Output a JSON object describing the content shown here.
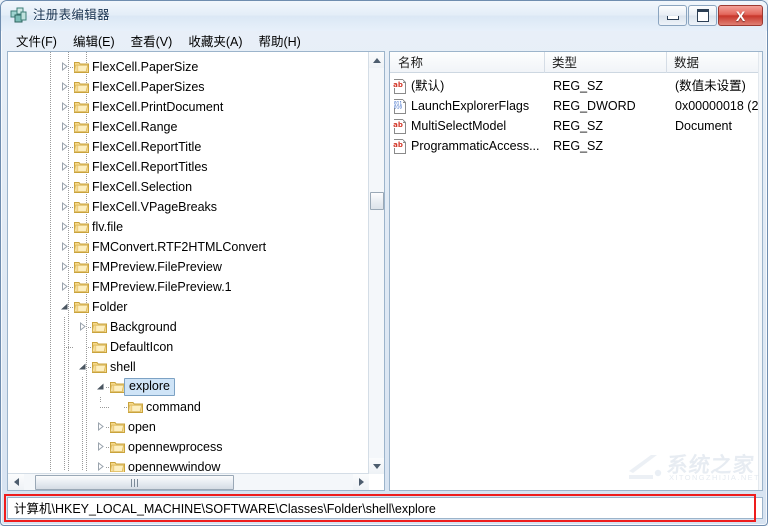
{
  "window": {
    "title": "注册表编辑器",
    "icon": "registry-editor-icon",
    "controls": {
      "minimize": "—",
      "maximize": "□",
      "close": "X"
    }
  },
  "menubar": {
    "items": [
      {
        "label": "文件(F)"
      },
      {
        "label": "编辑(E)"
      },
      {
        "label": "查看(V)"
      },
      {
        "label": "收藏夹(A)"
      },
      {
        "label": "帮助(H)"
      }
    ]
  },
  "tree": {
    "nodes": [
      {
        "label": "FlexCell.PaperSize",
        "depth": 3,
        "state": "collapsed",
        "selected": false
      },
      {
        "label": "FlexCell.PaperSizes",
        "depth": 3,
        "state": "collapsed",
        "selected": false
      },
      {
        "label": "FlexCell.PrintDocument",
        "depth": 3,
        "state": "collapsed",
        "selected": false
      },
      {
        "label": "FlexCell.Range",
        "depth": 3,
        "state": "collapsed",
        "selected": false
      },
      {
        "label": "FlexCell.ReportTitle",
        "depth": 3,
        "state": "collapsed",
        "selected": false
      },
      {
        "label": "FlexCell.ReportTitles",
        "depth": 3,
        "state": "collapsed",
        "selected": false
      },
      {
        "label": "FlexCell.Selection",
        "depth": 3,
        "state": "collapsed",
        "selected": false
      },
      {
        "label": "FlexCell.VPageBreaks",
        "depth": 3,
        "state": "collapsed",
        "selected": false
      },
      {
        "label": "flv.file",
        "depth": 3,
        "state": "collapsed",
        "selected": false
      },
      {
        "label": "FMConvert.RTF2HTMLConvert",
        "depth": 3,
        "state": "collapsed",
        "selected": false
      },
      {
        "label": "FMPreview.FilePreview",
        "depth": 3,
        "state": "collapsed",
        "selected": false
      },
      {
        "label": "FMPreview.FilePreview.1",
        "depth": 3,
        "state": "collapsed",
        "selected": false
      },
      {
        "label": "Folder",
        "depth": 3,
        "state": "expanded",
        "selected": false
      },
      {
        "label": "Background",
        "depth": 4,
        "state": "collapsed",
        "selected": false
      },
      {
        "label": "DefaultIcon",
        "depth": 4,
        "state": "leaf",
        "selected": false
      },
      {
        "label": "shell",
        "depth": 4,
        "state": "expanded",
        "selected": false
      },
      {
        "label": "explore",
        "depth": 5,
        "state": "expanded",
        "selected": true
      },
      {
        "label": "command",
        "depth": 6,
        "state": "leaf",
        "selected": false
      },
      {
        "label": "open",
        "depth": 5,
        "state": "collapsed",
        "selected": false
      },
      {
        "label": "opennewprocess",
        "depth": 5,
        "state": "collapsed",
        "selected": false
      },
      {
        "label": "opennewwindow",
        "depth": 5,
        "state": "collapsed",
        "selected": false
      }
    ],
    "scrollbar": {
      "up_arrow_icon": "triangle-up-icon",
      "down_arrow_icon": "triangle-down-icon",
      "left_arrow_icon": "triangle-left-icon",
      "right_arrow_icon": "triangle-right-icon"
    }
  },
  "list": {
    "columns": [
      {
        "label": "名称"
      },
      {
        "label": "类型"
      },
      {
        "label": "数据"
      }
    ],
    "rows": [
      {
        "icon": "string-value-icon",
        "name": "(默认)",
        "type": "REG_SZ",
        "data": "(数值未设置)"
      },
      {
        "icon": "dword-value-icon",
        "name": "LaunchExplorerFlags",
        "type": "REG_DWORD",
        "data": "0x00000018 (2"
      },
      {
        "icon": "string-value-icon",
        "name": "MultiSelectModel",
        "type": "REG_SZ",
        "data": "Document"
      },
      {
        "icon": "string-value-icon",
        "name": "ProgrammaticAccess...",
        "type": "REG_SZ",
        "data": ""
      }
    ]
  },
  "statusbar": {
    "path": "计算机\\HKEY_LOCAL_MACHINE\\SOFTWARE\\Classes\\Folder\\shell\\explore"
  },
  "watermark": {
    "text": "系统之家",
    "subtext": "XITONGZHIJIA.NET"
  },
  "colors": {
    "highlight_box": "#ee1d1d",
    "selection_fill": "#cfe4f7",
    "selection_border": "#7da2c4",
    "close_button": "#c8362b",
    "folder_icon": "#f0c860",
    "string_icon": "#d33a2c",
    "dword_icon": "#2f62c4"
  }
}
